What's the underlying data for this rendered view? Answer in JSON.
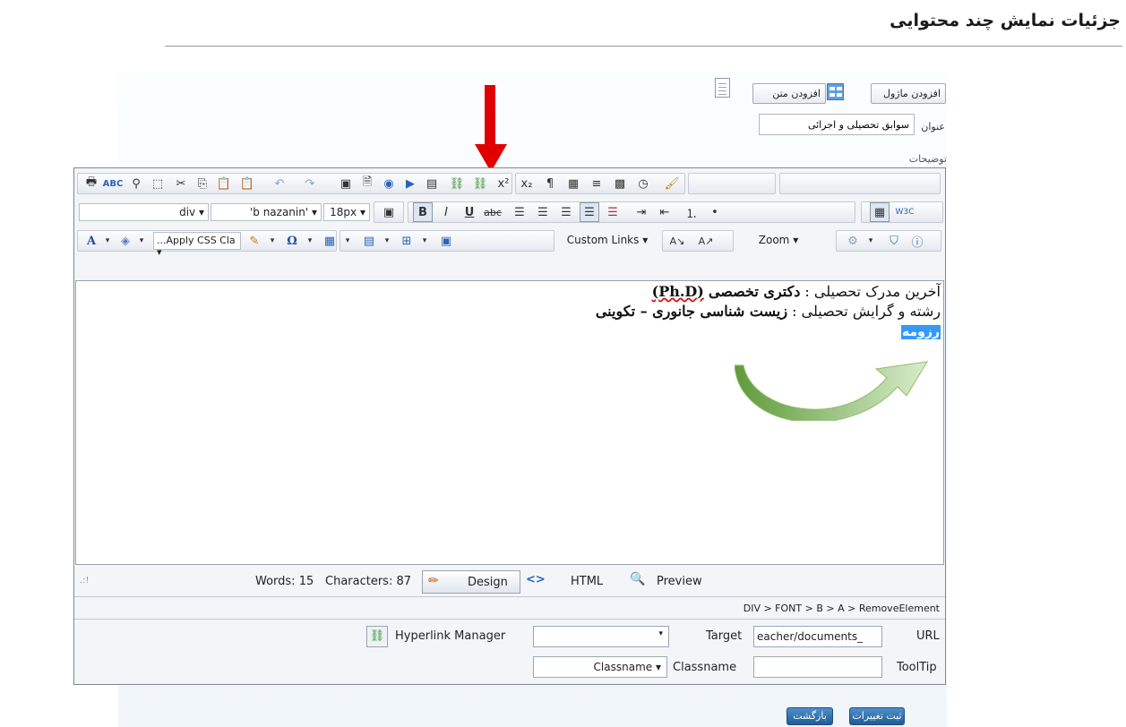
{
  "page": {
    "title": "جزئیات نمایش چند محتوایی"
  },
  "actions": {
    "add_module_label": "افزودن ماژول",
    "add_text_label": "افزودن متن",
    "save_label": "ثبت تغییرات",
    "back_label": "بازگشت"
  },
  "form": {
    "title_label": "عنوان",
    "title_value": "سوابق تحصیلی و اجرائی",
    "description_label": "توضیحات"
  },
  "editor": {
    "font_element": "div",
    "font_name": "'b nazanin'",
    "font_size": "18px",
    "css_class": "...Apply CSS Cla",
    "custom_links": "Custom Links",
    "zoom": "Zoom",
    "content": {
      "line1_prefix": "آخرین مدرک تحصیلی : ",
      "line1_bold": "دکتری تخصصی",
      "line1_phd": "(Ph.D)",
      "line2_prefix": "رشته و گرایش تحصیلی : ",
      "line2_bold": "زیست شناسی جانوری – تکوینی",
      "line3_selected": "رزومه"
    },
    "status": {
      "words": "Words: 15",
      "characters": "Characters: 87",
      "design_tab": "Design",
      "html_tab": "HTML",
      "preview_tab": "Preview"
    },
    "dom_path": "DIV > FONT > B > A > RemoveElement",
    "link_panel": {
      "hyperlink_manager": "Hyperlink Manager",
      "target_label": "Target",
      "url_value": "eacher/documents_",
      "url_label": "URL",
      "classname_dropdown": "Classname",
      "classname_label": "Classname",
      "tooltip_label": "ToolTip"
    }
  },
  "colors": {
    "annotation_arrow": "#e00000",
    "curved_arrow": "#8bbf5f",
    "selection": "#3399ff",
    "button_blue": "#2a6aa8"
  }
}
